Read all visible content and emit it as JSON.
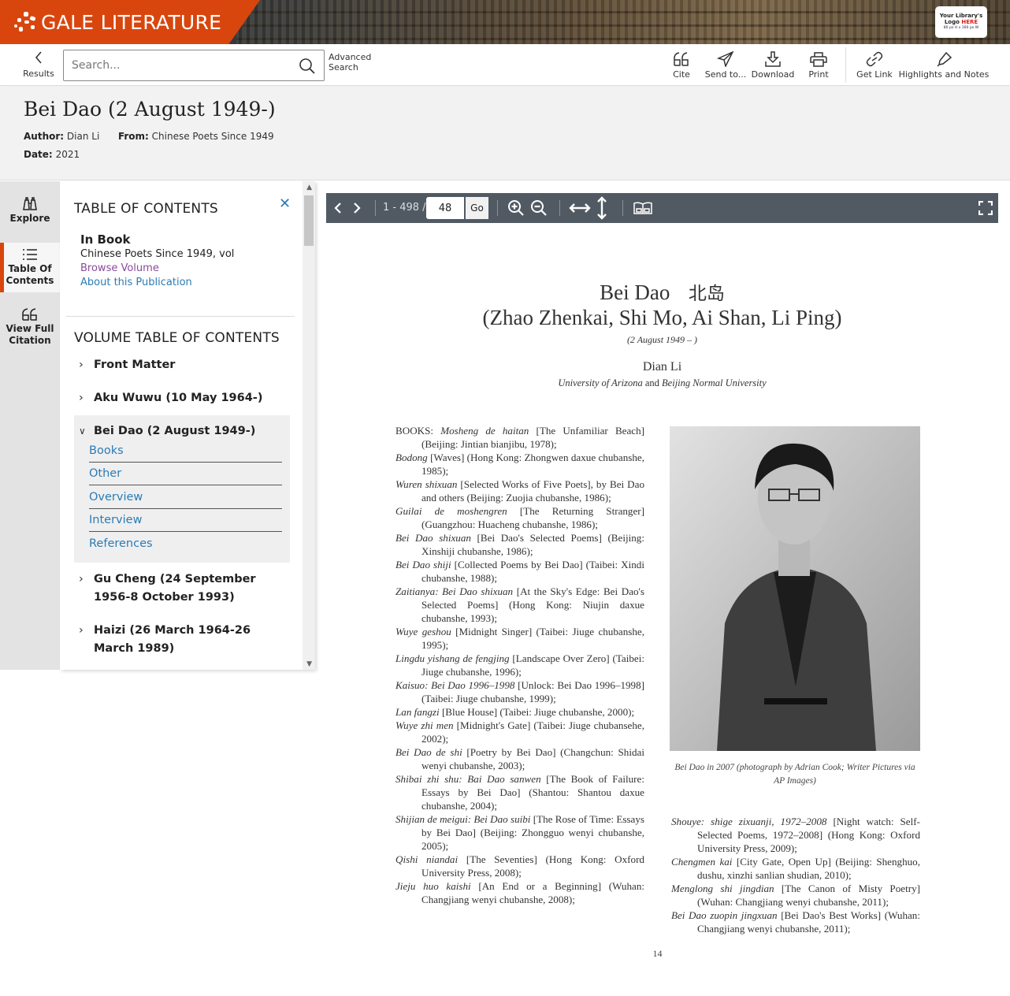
{
  "brand": {
    "name": "GALE LITERATURE",
    "color": "#d8460e",
    "library_logo": {
      "line1": "Your Library's",
      "line2_pre": "Logo ",
      "line2_highlight": "HERE",
      "line3": "80 px H x 160 px W"
    }
  },
  "toolbar": {
    "back_label": "Results",
    "search_placeholder": "Search...",
    "advanced_search": "Advanced Search",
    "tools": [
      {
        "label": "Cite",
        "icon": "quote-icon"
      },
      {
        "label": "Send to...",
        "icon": "send-icon"
      },
      {
        "label": "Download",
        "icon": "download-icon"
      },
      {
        "label": "Print",
        "icon": "print-icon"
      },
      {
        "label": "Get Link",
        "icon": "link-icon"
      },
      {
        "label": "Highlights and Notes",
        "icon": "highlighter-icon"
      }
    ]
  },
  "document": {
    "title": "Bei Dao (2 August 1949-)",
    "author_label": "Author:",
    "author": "Dian Li",
    "from_label": "From:",
    "from": "Chinese Poets Since 1949",
    "date_label": "Date:",
    "date": "2021"
  },
  "rail": {
    "items": [
      {
        "label": "Explore",
        "icon": "binoculars-icon",
        "active": false
      },
      {
        "label": "Table Of Contents",
        "icon": "list-icon",
        "active": true
      },
      {
        "label": "View Full Citation",
        "icon": "quote-icon",
        "active": false
      }
    ]
  },
  "toc": {
    "heading": "TABLE OF CONTENTS",
    "in_book_label": "In Book",
    "book_title": "Chinese Poets Since 1949, vol",
    "browse_volume": "Browse Volume",
    "about_publication": "About this Publication",
    "volume_heading": "VOLUME TABLE OF CONTENTS",
    "entries": [
      {
        "label": "Front Matter",
        "expanded": false
      },
      {
        "label": "Aku Wuwu (10 May 1964-)",
        "expanded": false
      },
      {
        "label": "Bei Dao (2 August 1949-)",
        "expanded": true,
        "children": [
          "Books",
          "Other",
          "Overview",
          "Interview",
          "References"
        ]
      },
      {
        "label": "Gu Cheng (24 September 1956-8 October 1993)",
        "expanded": false
      },
      {
        "label": "Haizi (26 March 1964-26 March 1989)",
        "expanded": false
      }
    ]
  },
  "viewer": {
    "page_range": "1 - 498 /",
    "current_page": "48",
    "go_label": "Go"
  },
  "page": {
    "heading_en": "Bei Dao",
    "heading_zh": "北岛",
    "aliases": "(Zhao Zhenkai, Shi Mo, Ai Shan, Li Ping)",
    "dates": "(2 August 1949 –    )",
    "author": "Dian Li",
    "affiliation_a": "University of Arizona",
    "affiliation_and": " and ",
    "affiliation_b": "Beijing Normal University",
    "caption": "Bei Dao in 2007 (photograph by Adrian Cook; Writer Pictures via AP Images)",
    "page_number": "14",
    "books_label": "BOOKS:",
    "books_left": [
      {
        "title": "Mosheng de haitan",
        "rest": " [The Unfamiliar Beach] (Beijing: Jintian bianjibu, 1978);"
      },
      {
        "title": "Bodong",
        "rest": " [Waves] (Hong Kong: Zhongwen daxue chubanshe, 1985);"
      },
      {
        "title": "Wuren shixuan",
        "rest": " [Selected Works of Five Poets], by Bei Dao and others (Beijing: Zuojia chubanshe, 1986);"
      },
      {
        "title": "Guilai de moshengren",
        "rest": " [The Returning Stranger] (Guangzhou: Huacheng chubanshe, 1986);"
      },
      {
        "title": "Bei Dao shixuan",
        "rest": " [Bei Dao's Selected Poems] (Beijing: Xinshiji chubanshe, 1986);"
      },
      {
        "title": "Bei Dao shiji",
        "rest": " [Collected Poems by Bei Dao] (Taibei: Xindi chubanshe, 1988);"
      },
      {
        "title": "Zaitianya: Bei Dao shixuan",
        "rest": " [At the Sky's Edge: Bei Dao's Selected Poems] (Hong Kong: Niujin daxue chubanshe, 1993);"
      },
      {
        "title": "Wuye geshou",
        "rest": " [Midnight Singer] (Taibei: Jiuge chubanshe, 1995);"
      },
      {
        "title": "Lingdu yishang de fengjing",
        "rest": " [Landscape Over Zero] (Taibei: Jiuge chubanshe, 1996);"
      },
      {
        "title": "Kaisuo: Bei Dao 1996–1998",
        "rest": " [Unlock: Bei Dao 1996–1998] (Taibei: Jiuge chubanshe, 1999);"
      },
      {
        "title": "Lan fangzi",
        "rest": " [Blue House] (Taibei: Jiuge chubanshe, 2000);"
      },
      {
        "title": "Wuye zhi men",
        "rest": " [Midnight's Gate] (Taibei: Jiuge chubansehe, 2002);"
      },
      {
        "title": "Bei Dao de shi",
        "rest": " [Poetry by Bei Dao] (Changchun: Shidai wenyi chubanshe, 2003);"
      },
      {
        "title": "Shibai zhi shu: Bai Dao sanwen",
        "rest": " [The Book of Failure: Essays by Bei Dao] (Shantou: Shantou daxue chubanshe, 2004);"
      },
      {
        "title": "Shijian de meigui: Bei Dao suibi",
        "rest": " [The Rose of Time: Essays by Bei Dao] (Beijing: Zhongguo wenyi chubanshe, 2005);"
      },
      {
        "title": "Qishi niandai",
        "rest": " [The Seventies] (Hong Kong: Oxford University Press, 2008);"
      },
      {
        "title": "Jieju huo kaishi",
        "rest": " [An End or a Beginning] (Wuhan: Changjiang wenyi chubanshe, 2008);"
      }
    ],
    "books_right": [
      {
        "title": "Shouye: shige zixuanji, 1972–2008",
        "rest": " [Night watch: Self-Selected Poems, 1972–2008] (Hong Kong: Oxford University Press, 2009);"
      },
      {
        "title": "Chengmen kai",
        "rest": " [City Gate, Open Up] (Beijing: Shenghuo, dushu, xinzhi sanlian shudian, 2010);"
      },
      {
        "title": "Menglong shi jingdian",
        "rest": " [The Canon of Misty Poetry] (Wuhan: Changjiang wenyi chubanshe, 2011);"
      },
      {
        "title": "Bei Dao zuopin jingxuan",
        "rest": " [Bei Dao's Best Works] (Wuhan: Changjiang wenyi chubanshe, 2011);"
      }
    ]
  }
}
